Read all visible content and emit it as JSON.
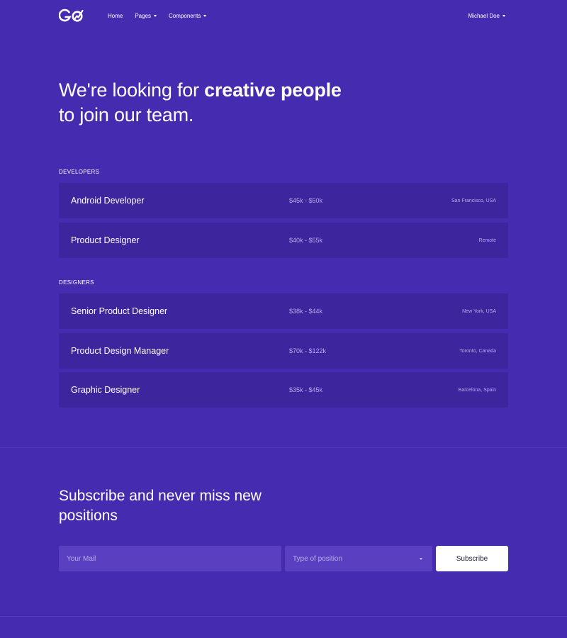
{
  "navbar": {
    "logo_text": "GO",
    "links": [
      {
        "label": "Home"
      },
      {
        "label": "Pages"
      },
      {
        "label": "Components"
      }
    ],
    "user_name": "Michael Doe"
  },
  "hero": {
    "line1_prefix": "We're looking for ",
    "line1_bold": "creative people",
    "line2": "to join our team."
  },
  "job_groups": [
    {
      "label": "DEVELOPERS",
      "jobs": [
        {
          "title": "Android Developer",
          "salary": "$45k - $50k",
          "location": "San Francisco, USA"
        },
        {
          "title": "Product Designer",
          "salary": "$40k - $55k",
          "location": "Remote"
        }
      ]
    },
    {
      "label": "DESIGNERS",
      "jobs": [
        {
          "title": "Senior Product Designer",
          "salary": "$38k - $44k",
          "location": "New York, USA"
        },
        {
          "title": "Product Design Manager",
          "salary": "$70k - $122k",
          "location": "Toronto, Canada"
        },
        {
          "title": "Graphic Designer",
          "salary": "$35k - $45k",
          "location": "Barcelona, Spain"
        }
      ]
    }
  ],
  "subscribe": {
    "title": "Subscribe and never miss new positions",
    "email_placeholder": "Your Mail",
    "position_select": "Type of position",
    "button_label": "Subscribe"
  },
  "colors": {
    "background": "#452bb0",
    "row_background": "#3d259d",
    "input_background": "#5a40c0",
    "button_background": "#ffffff"
  }
}
